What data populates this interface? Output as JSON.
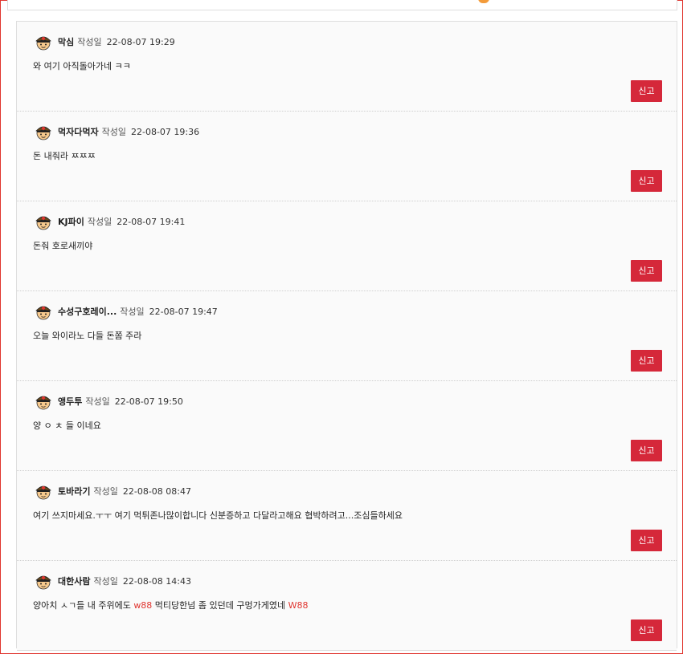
{
  "labels": {
    "date_label": "작성일",
    "report_button": "신고"
  },
  "comments": [
    {
      "nick": "막심",
      "date": "22-08-07 19:29",
      "text": "와 여기 아직돌아가네 ㅋㅋ"
    },
    {
      "nick": "먹자다먹자",
      "date": "22-08-07 19:36",
      "text": "돈 내줘라 ㅉㅉㅉ"
    },
    {
      "nick": "KJ파이",
      "date": "22-08-07 19:41",
      "text": "돈줘 호로새끼야"
    },
    {
      "nick": "수성구호레이...",
      "date": "22-08-07 19:47",
      "text": "오늘 와이라노 다들 돈쫌 주라"
    },
    {
      "nick": "앵두투",
      "date": "22-08-07 19:50",
      "text": "양 ㅇ ㅊ 들 이네요"
    },
    {
      "nick": "토바라기",
      "date": "22-08-08 08:47",
      "text": "여기 쓰지마세요.ㅜㅜ 여기 먹튀존나많이합니다 신분증하고 다달라고해요 협박하려고...조심들하세요"
    },
    {
      "nick": "대한사람",
      "date": "22-08-08 14:43",
      "text_part1": "양아치 ㅅㄱ들 내 주위에도 ",
      "text_red1": "w88",
      "text_part2": " 먹티당한넘 좀 있던데 구멍가게였네 ",
      "text_red2": "W88"
    }
  ],
  "colors": {
    "accent": "#d5283a",
    "frame": "#e0352f"
  },
  "icons": {
    "avatar": "soldier-avatar-icon"
  }
}
